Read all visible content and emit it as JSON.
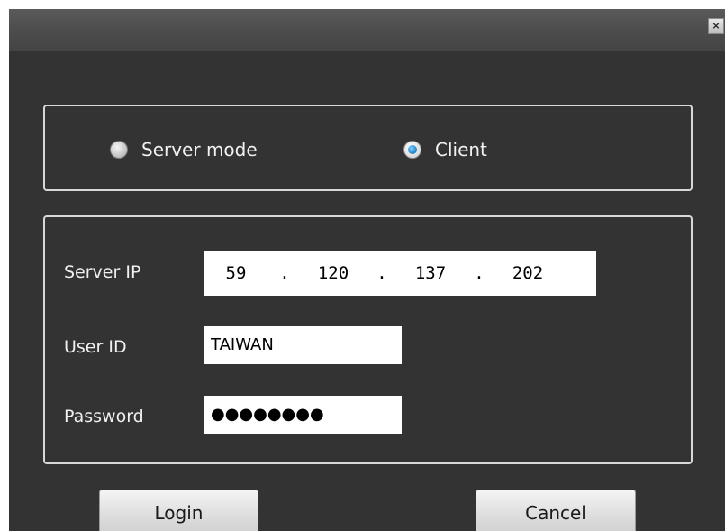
{
  "window": {
    "close_label": "×"
  },
  "mode": {
    "options": [
      {
        "label": "Server mode",
        "selected": false
      },
      {
        "label": "Client",
        "selected": true
      }
    ]
  },
  "login": {
    "server_ip_label": "Server IP",
    "server_ip": [
      "59",
      "120",
      "137",
      "202"
    ],
    "ip_separator": ".",
    "user_id_label": "User ID",
    "user_id_value": "TAIWAN",
    "password_label": "Password",
    "password_mask": "●●●●●●●●"
  },
  "buttons": {
    "login_label": "Login",
    "cancel_label": "Cancel"
  },
  "colors": {
    "dialog_bg": "#333333",
    "titlebar_bg": "#4c4c4c",
    "radio_selected": "#1b7fc9",
    "group_border": "#d8d8d8"
  }
}
